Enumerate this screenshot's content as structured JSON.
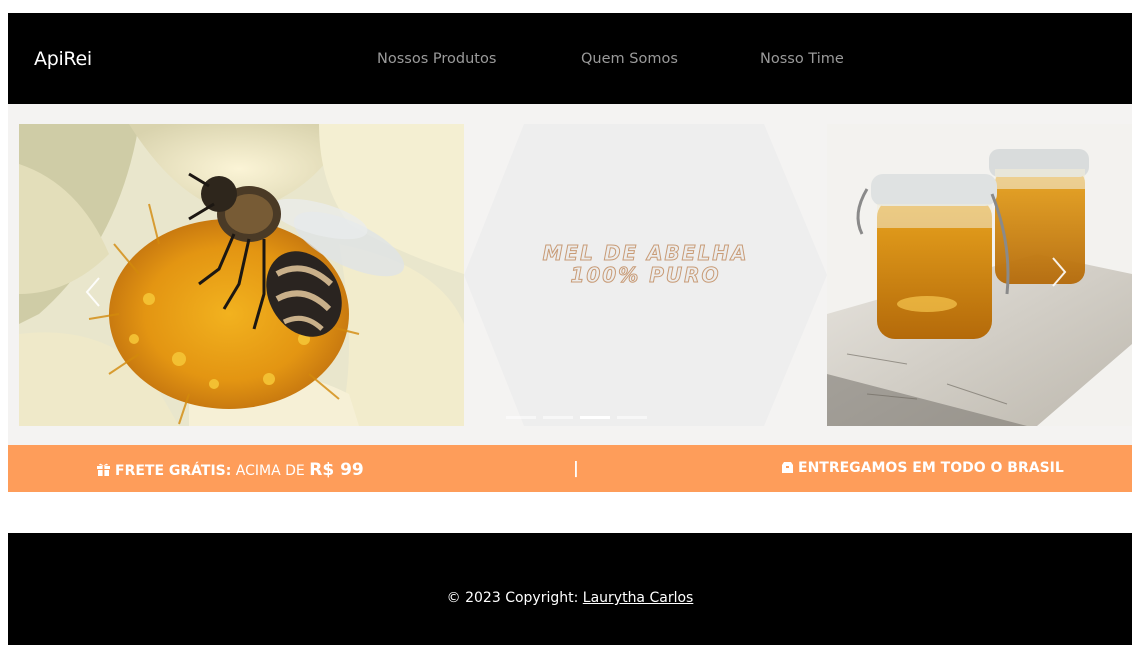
{
  "navbar": {
    "brand": "ApiRei",
    "links": [
      "Nossos Produtos",
      "Quem Somos",
      "Nosso Time"
    ]
  },
  "hero": {
    "title_line1": "MEL DE ABELHA",
    "title_line2": "100% PURO",
    "prev_icon": "chevron-left-icon",
    "next_icon": "chevron-right-icon",
    "indicators": {
      "count": 4,
      "active": 3
    }
  },
  "promo": {
    "left_bold": "FRETE GRÁTIS:",
    "left_text": " ACIMA DE ",
    "left_price": "R$ 99",
    "separator": "|",
    "right_text": "ENTREGAMOS EM TODO O BRASIL",
    "left_icon": "gift-icon",
    "right_icon": "box-icon",
    "color": "#fe9d5a"
  },
  "footer": {
    "copyright": "© 2023 Copyright: ",
    "author": "Laurytha Carlos"
  }
}
